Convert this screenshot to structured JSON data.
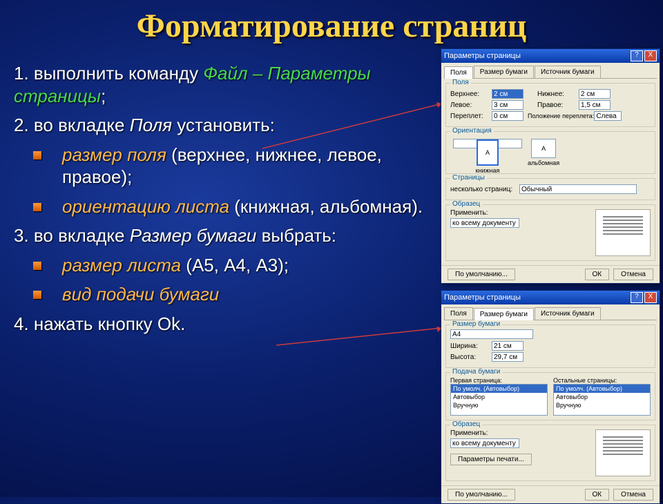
{
  "title": "Форматирование страниц",
  "steps": {
    "s1_a": "1. выполнить команду ",
    "s1_b": "Файл – Параметры страницы",
    "s1_c": ";",
    "s2_a": "2. во вкладке ",
    "s2_b": "Поля",
    "s2_c": " установить:",
    "b1_a": "размер поля",
    "b1_b": " (верхнее, нижнее, левое, правое);",
    "b2_a": "ориентацию листа",
    "b2_b": " (книжная, альбомная).",
    "s3_a": "3. во вкладке ",
    "s3_b": "Размер бумаги",
    "s3_c": " выбрать:",
    "b3_a": "размер листа",
    "b3_b": " (А5, А4, А3);",
    "b4_a": "вид подачи бумаги",
    "s4": "4. нажать  кнопку  Ok."
  },
  "dlg": {
    "title": "Параметры страницы",
    "help": "?",
    "close": "X",
    "tabs": {
      "t1": "Поля",
      "t2": "Размер бумаги",
      "t3": "Источник бумаги"
    },
    "fields": {
      "group": "Поля",
      "top_l": "Верхнее:",
      "top_v": "2 см",
      "bot_l": "Нижнее:",
      "bot_v": "2 см",
      "left_l": "Левое:",
      "left_v": "3 см",
      "right_l": "Правое:",
      "right_v": "1,5 см",
      "gut_l": "Переплет:",
      "gut_v": "0 см",
      "gutpos_l": "Положение переплета:",
      "gutpos_v": "Слева"
    },
    "orient": {
      "group": "Ориентация",
      "port": "книжная",
      "land": "альбомная"
    },
    "pages": {
      "group": "Страницы",
      "multi_l": "несколько страниц:",
      "multi_v": "Обычный"
    },
    "sample": {
      "group": "Образец",
      "apply_l": "Применить:",
      "apply_v": "ко всему документу"
    },
    "paper": {
      "group": "Размер бумаги",
      "size_v": "A4",
      "w_l": "Ширина:",
      "w_v": "21 см",
      "h_l": "Высота:",
      "h_v": "29,7 см"
    },
    "feed": {
      "group": "Подача бумаги",
      "first_l": "Первая страница:",
      "other_l": "Остальные страницы:",
      "opt1": "По умолч. (Автовыбор)",
      "opt2": "Автовыбор",
      "opt3": "Вручную"
    },
    "btns": {
      "default": "По умолчанию...",
      "print": "Параметры печати...",
      "ok": "ОК",
      "cancel": "Отмена"
    }
  }
}
